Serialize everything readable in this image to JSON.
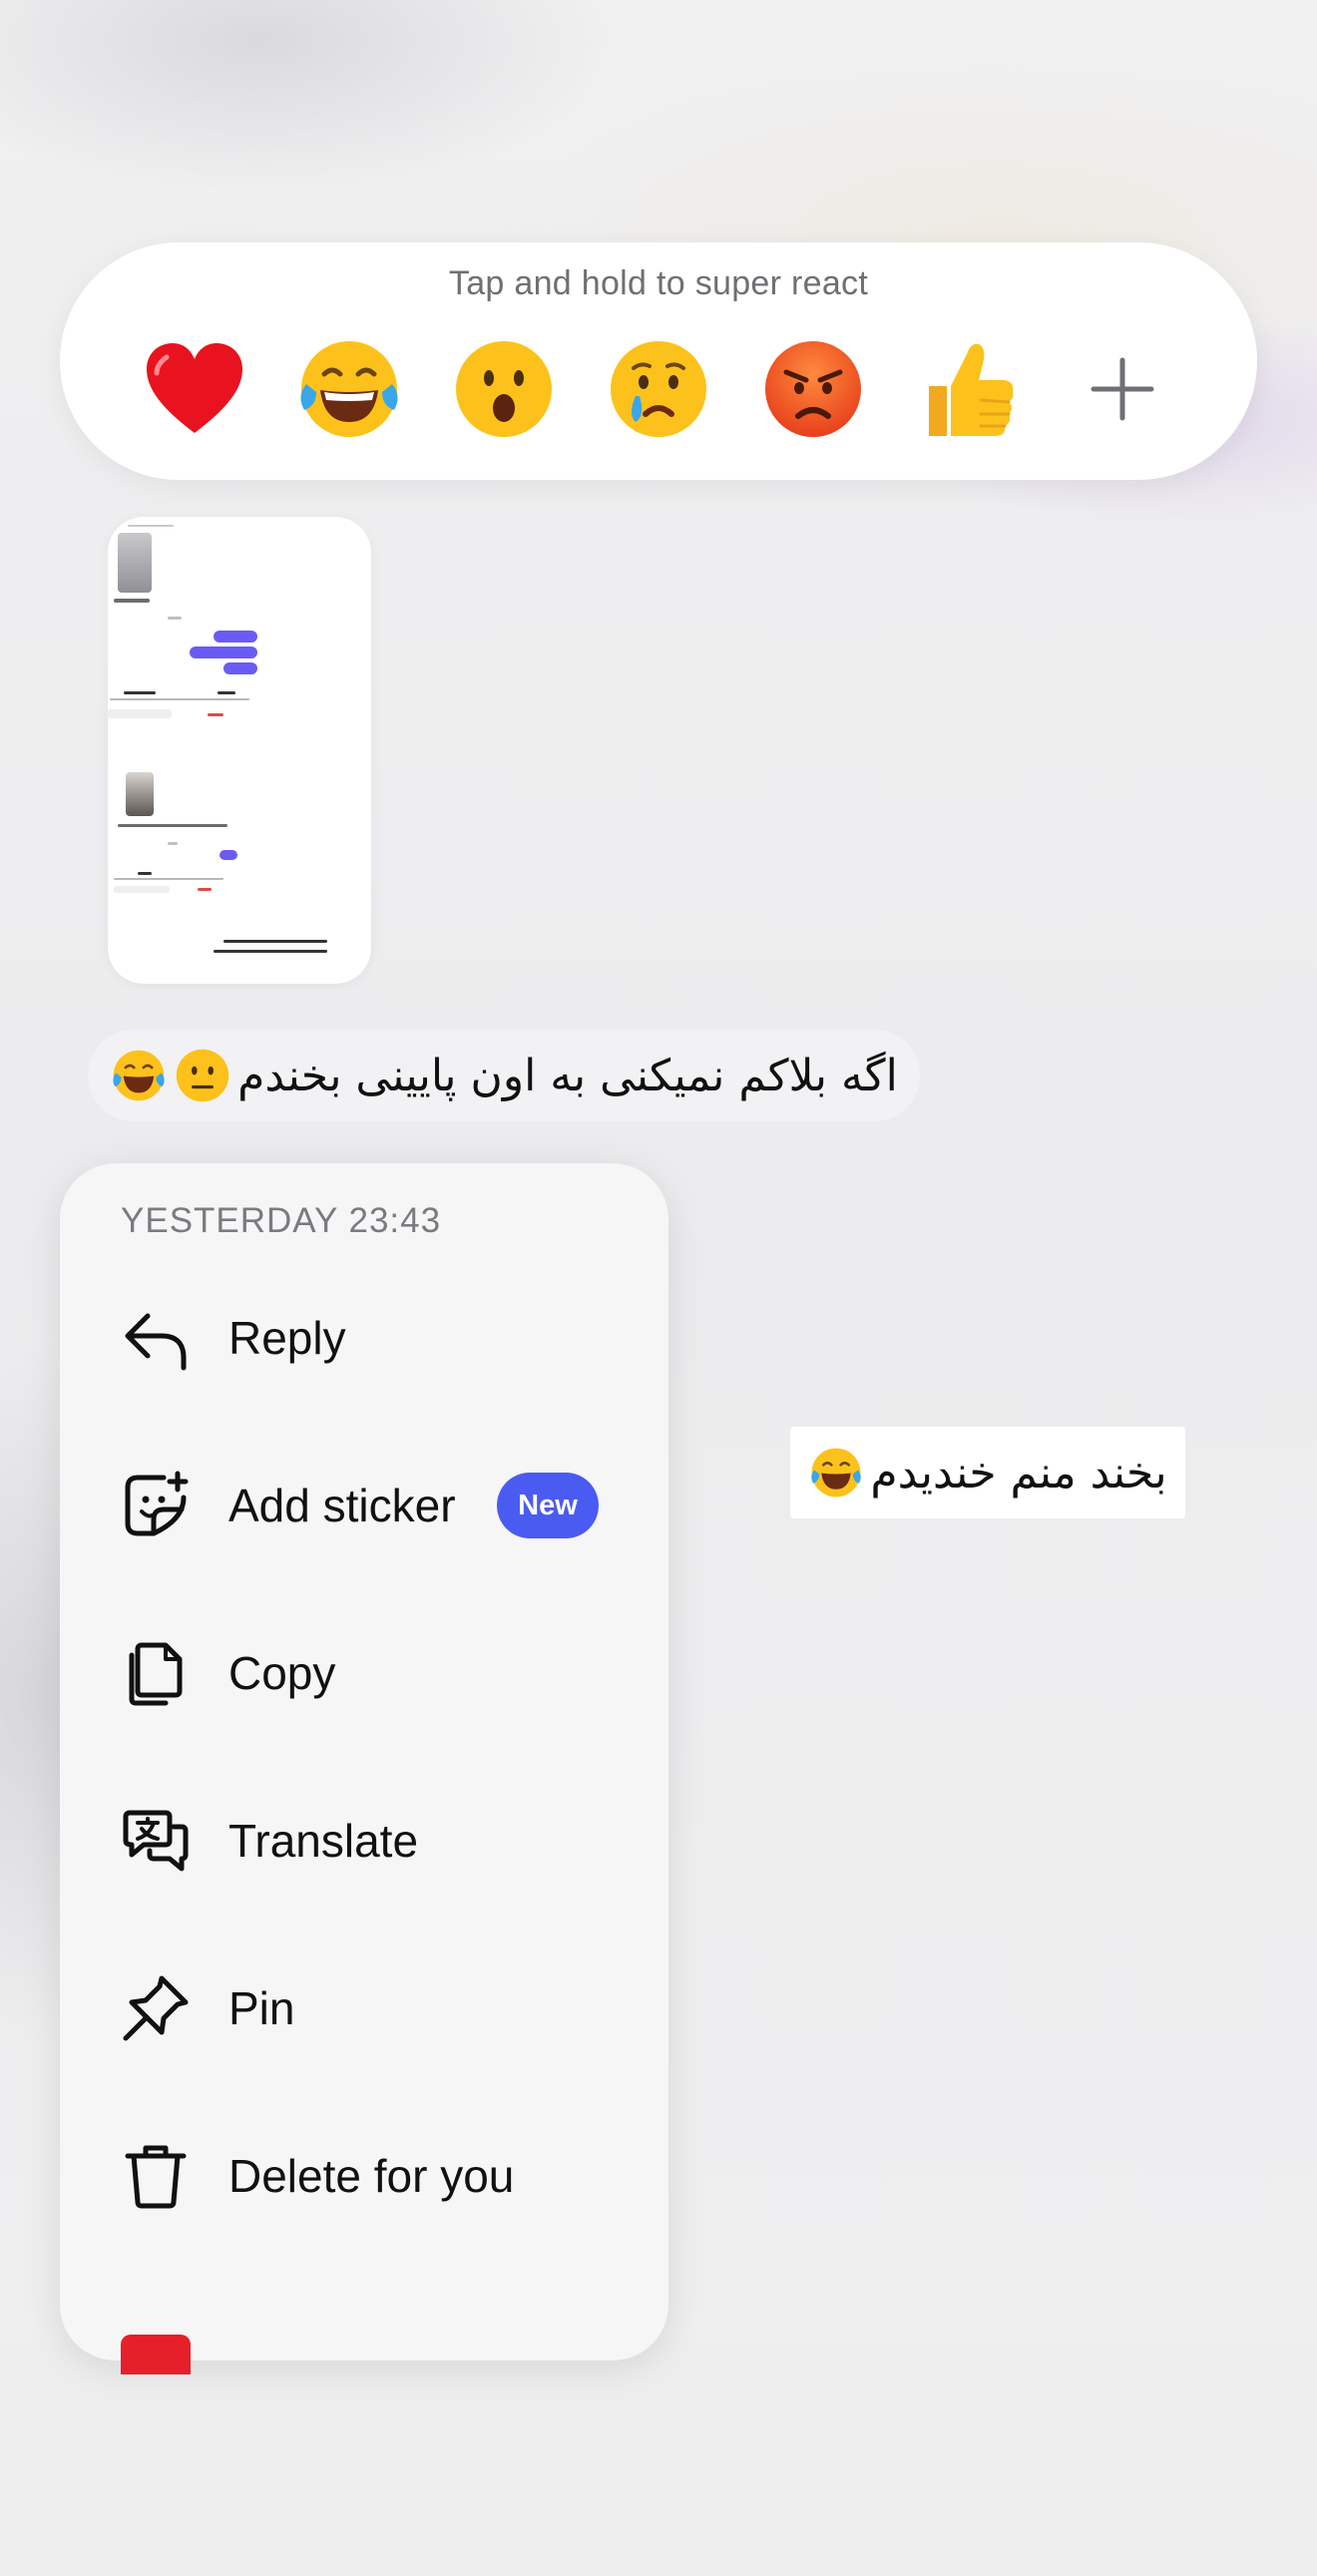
{
  "reaction_bar": {
    "hint": "Tap and hold to super react",
    "reactions": [
      {
        "icon": "red-heart-emoji"
      },
      {
        "icon": "tears-of-joy-emoji"
      },
      {
        "icon": "astonished-face-emoji"
      },
      {
        "icon": "crying-face-emoji"
      },
      {
        "icon": "angry-face-emoji"
      },
      {
        "icon": "thumbs-up-emoji"
      },
      {
        "icon": "plus-icon"
      }
    ]
  },
  "messages": {
    "incoming_text": "اگه بلاکم نمیکنی به اون پایینی بخندم",
    "incoming_emojis": [
      "neutral-face-emoji",
      "tears-of-joy-emoji"
    ],
    "outgoing_text": "بخند منم خندیدم",
    "outgoing_emoji": "tears-of-joy-emoji"
  },
  "context_menu": {
    "timestamp": "YESTERDAY 23:43",
    "items": [
      {
        "label": "Reply",
        "icon": "reply-icon"
      },
      {
        "label": "Add sticker",
        "icon": "sticker-icon",
        "badge": "New"
      },
      {
        "label": "Copy",
        "icon": "copy-icon"
      },
      {
        "label": "Translate",
        "icon": "translate-icon"
      },
      {
        "label": "Pin",
        "icon": "pin-icon"
      },
      {
        "label": "Delete for you",
        "icon": "trash-icon"
      }
    ]
  },
  "colors": {
    "badge": "#4a5bf2",
    "bubble_accent": "#6a5cf2",
    "menu_bg": "#f6f6f7"
  }
}
